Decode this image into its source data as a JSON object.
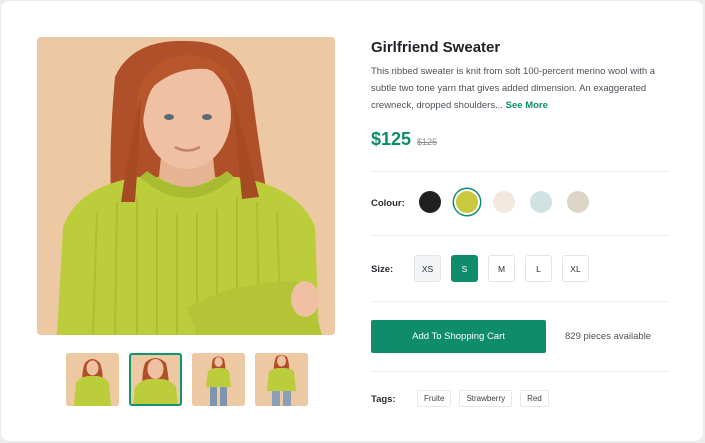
{
  "product": {
    "title": "Girlfriend Sweater",
    "description": "This ribbed sweater is knit from soft 100-percent merino wool with a subtle two tone yarn that gives added dimension. An exaggerated crewneck, dropped shoulders...",
    "see_more": "See More",
    "price": "$125",
    "old_price": "$125"
  },
  "colour": {
    "label": "Colour:",
    "options": [
      {
        "name": "black",
        "hex": "#202020"
      },
      {
        "name": "lime",
        "hex": "#c9c93d"
      },
      {
        "name": "cream",
        "hex": "#f1e8de"
      },
      {
        "name": "mint",
        "hex": "#d0e3e2"
      },
      {
        "name": "beige",
        "hex": "#ddd6c8"
      }
    ],
    "selected_index": 1
  },
  "size": {
    "label": "Size:",
    "options": [
      "XS",
      "S",
      "M",
      "L",
      "XL"
    ],
    "selected": "S"
  },
  "cart": {
    "button_label": "Add To Shopping Cart",
    "availability": "829 pieces available"
  },
  "tags": {
    "label": "Tags:",
    "items": [
      "Fruite",
      "Strawberry",
      "Red"
    ]
  },
  "gallery": {
    "thumbnail_count": 4,
    "active_index": 1
  },
  "colors": {
    "accent": "#0f8d6b",
    "background": "#ecc9a3",
    "sweater": "#bccd3c",
    "hair": "#b7552b"
  }
}
